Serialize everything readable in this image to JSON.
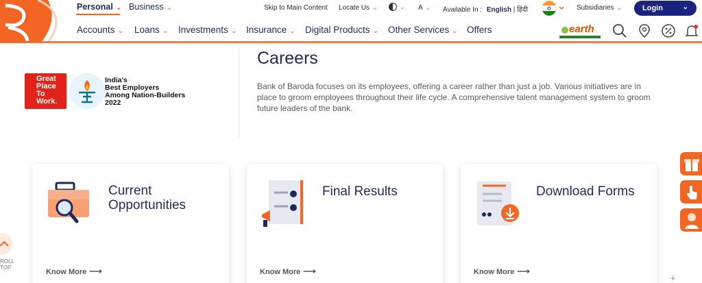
{
  "header": {
    "tabs": [
      {
        "label": "Personal",
        "active": true
      },
      {
        "label": "Business",
        "active": false
      }
    ],
    "utilities": {
      "skip": "Skip to Main Content",
      "locate": "Locate Us",
      "font": "A",
      "available_in": "Available In :",
      "lang_english": "English",
      "lang_sep": "|",
      "lang_hindi": "हिंदी",
      "subsidiaries": "Subsidiaries",
      "login": "Login"
    },
    "nav": [
      "Accounts",
      "Loans",
      "Investments",
      "Insurance",
      "Digital Products",
      "Other Services",
      "Offers"
    ],
    "earth_label": "earth"
  },
  "award": {
    "gptw_line1": "Great",
    "gptw_line2": "Place",
    "gptw_line3": "To",
    "gptw_line4": "Work.",
    "line1": "India's",
    "line2": "Best Employers",
    "line3": "Among Nation-Builders",
    "year": "2022"
  },
  "main": {
    "title": "Careers",
    "description": "Bank of Baroda focuses on its employees, offering a career rather than just a job. Various initiatives are in place to groom employees throughout their life cycle. A comprehensive talent management system to groom future leaders of the bank."
  },
  "cards": [
    {
      "title_line1": "Current",
      "title_line2": "Opportunities",
      "link": "Know More"
    },
    {
      "title_line1": "Final Results",
      "title_line2": "",
      "link": "Know More"
    },
    {
      "title_line1": "Download Forms",
      "title_line2": "",
      "link": "Know More"
    }
  ],
  "side": {
    "scroll_line1": "ROLL",
    "scroll_line2": "TOP"
  },
  "colors": {
    "brand_orange": "#f26522",
    "brand_navy": "#1e2a5a",
    "login_bg": "#1a237e"
  }
}
